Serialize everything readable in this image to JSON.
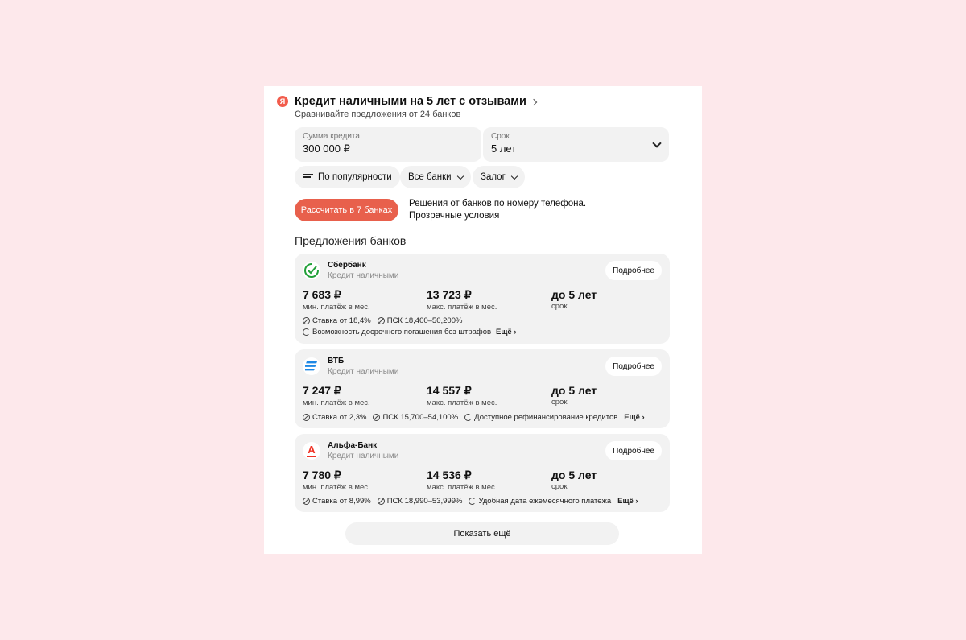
{
  "header": {
    "logo_letter": "Я",
    "title": "Кредит наличными на 5 лет с отзывами",
    "subtitle": "Сравнивайте предложения от 24 банков"
  },
  "form": {
    "amount_label": "Сумма кредита",
    "amount_value": "300 000 ₽",
    "term_label": "Срок",
    "term_value": "5 лет"
  },
  "filters": {
    "sort": "По популярности",
    "banks": "Все банки",
    "collateral": "Залог"
  },
  "calc": {
    "button": "Рассчитать в 7 банках",
    "promo_line1": "Решения от банков по номеру телефона.",
    "promo_line2": "Прозрачные условия"
  },
  "section_title": "Предложения банков",
  "offers": [
    {
      "bank": "Сбербанк",
      "type": "Кредит наличными",
      "details": "Подробнее",
      "min_payment": "7 683 ₽",
      "min_caption": "мин. платёж в мес.",
      "max_payment": "13 723 ₽",
      "max_caption": "макс. платёж в мес.",
      "term": "до 5 лет",
      "term_caption": "срок",
      "rate": "Ставка от 18,4%",
      "psk": "ПСК 18,400–50,200%",
      "feature": "Возможность досрочного погашения без штрафов",
      "more": "Ещё ›"
    },
    {
      "bank": "ВТБ",
      "type": "Кредит наличными",
      "details": "Подробнее",
      "min_payment": "7 247 ₽",
      "min_caption": "мин. платёж в мес.",
      "max_payment": "14 557 ₽",
      "max_caption": "макс. платёж в мес.",
      "term": "до 5 лет",
      "term_caption": "срок",
      "rate": "Ставка от 2,3%",
      "psk": "ПСК 15,700–54,100%",
      "feature": "Доступное рефинансирование кредитов",
      "more": "Ещё ›"
    },
    {
      "bank": "Альфа-Банк",
      "type": "Кредит наличными",
      "details": "Подробнее",
      "min_payment": "7 780 ₽",
      "min_caption": "мин. платёж в мес.",
      "max_payment": "14 536 ₽",
      "max_caption": "макс. платёж в мес.",
      "term": "до 5 лет",
      "term_caption": "срок",
      "rate": "Ставка от 8,99%",
      "psk": "ПСК 18,990–53,999%",
      "feature": "Удобная дата ежемесячного платежа",
      "more": "Ещё ›"
    }
  ],
  "alfa_logo_letter": "А",
  "show_more": "Показать ещё",
  "colors": {
    "background": "#fde8eb",
    "accent": "#e8604c",
    "card_bg": "#f2f2f2"
  }
}
